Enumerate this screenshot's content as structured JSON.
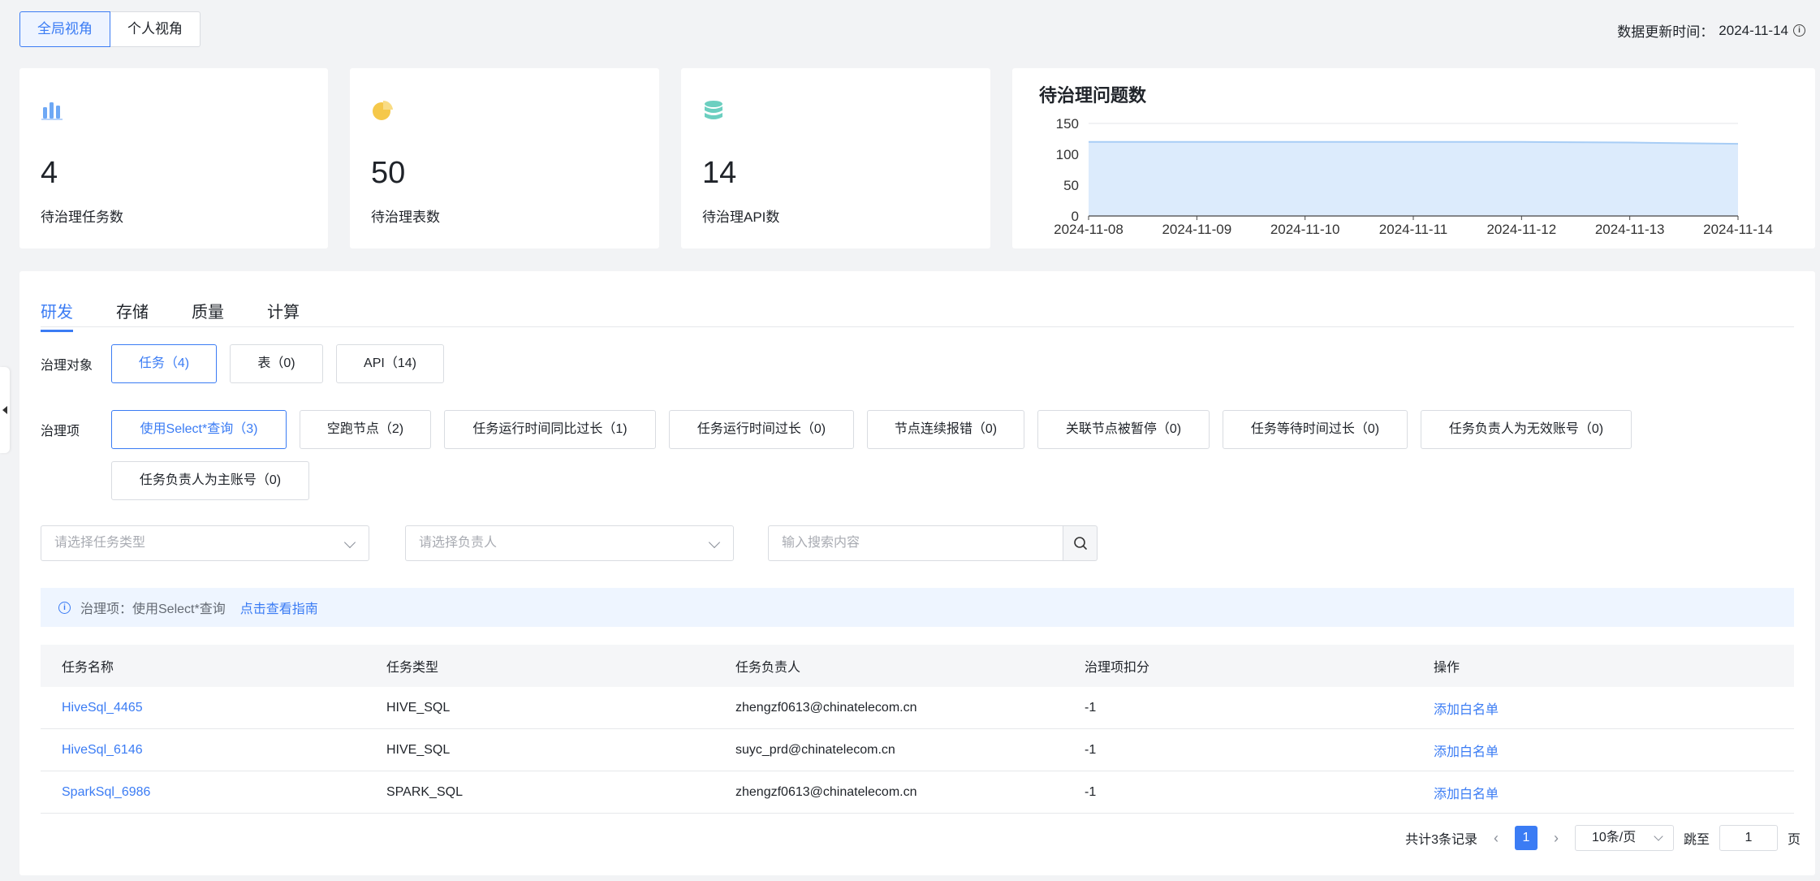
{
  "header": {
    "views": [
      {
        "label": "全局视角",
        "active": true
      },
      {
        "label": "个人视角",
        "active": false
      }
    ],
    "update_label": "数据更新时间：",
    "update_date": "2024-11-14"
  },
  "stats": [
    {
      "value": "4",
      "label": "待治理任务数",
      "icon": "bar-chart-icon",
      "color": "#6ea8f5"
    },
    {
      "value": "50",
      "label": "待治理表数",
      "icon": "pie-chart-icon",
      "color": "#f5c84a"
    },
    {
      "value": "14",
      "label": "待治理API数",
      "icon": "database-icon",
      "color": "#6ccfc0"
    }
  ],
  "chart_data": {
    "type": "area",
    "title": "待治理问题数",
    "x": [
      "2024-11-08",
      "2024-11-09",
      "2024-11-10",
      "2024-11-11",
      "2024-11-12",
      "2024-11-13",
      "2024-11-14"
    ],
    "series": [
      {
        "values": [
          120,
          120,
          120,
          120,
          120,
          119,
          117
        ]
      }
    ],
    "yticks": [
      "0",
      "50",
      "100",
      "150"
    ],
    "ylim": [
      0,
      150
    ],
    "grid": true,
    "color": "#a8cdf5",
    "fill": "#dcebfc"
  },
  "tabs": [
    {
      "label": "研发",
      "active": true
    },
    {
      "label": "存储",
      "active": false
    },
    {
      "label": "质量",
      "active": false
    },
    {
      "label": "计算",
      "active": false
    }
  ],
  "objects": {
    "label": "治理对象",
    "items": [
      {
        "label": "任务（4)",
        "active": true
      },
      {
        "label": "表（0)",
        "active": false
      },
      {
        "label": "API（14)",
        "active": false
      }
    ]
  },
  "governance": {
    "label": "治理项",
    "items": [
      {
        "label": "使用Select*查询（3)",
        "active": true
      },
      {
        "label": "空跑节点（2)",
        "active": false
      },
      {
        "label": "任务运行时间同比过长（1)",
        "active": false
      },
      {
        "label": "任务运行时间过长（0)",
        "active": false
      },
      {
        "label": "节点连续报错（0)",
        "active": false
      },
      {
        "label": "关联节点被暂停（0)",
        "active": false
      },
      {
        "label": "任务等待时间过长（0)",
        "active": false
      },
      {
        "label": "任务负责人为无效账号（0)",
        "active": false
      },
      {
        "label": "任务负责人为主账号（0)",
        "active": false
      }
    ]
  },
  "filters": {
    "task_type_placeholder": "请选择任务类型",
    "owner_placeholder": "请选择负责人",
    "search_placeholder": "输入搜索内容"
  },
  "notice": {
    "text": "治理项：使用Select*查询",
    "link": "点击查看指南"
  },
  "table": {
    "headers": [
      "任务名称",
      "任务类型",
      "任务负责人",
      "治理项扣分",
      "操作"
    ],
    "rows": [
      {
        "name": "HiveSql_4465",
        "type": "HIVE_SQL",
        "owner": "zhengzf0613@chinatelecom.cn",
        "score": "-1",
        "action": "添加白名单"
      },
      {
        "name": "HiveSql_6146",
        "type": "HIVE_SQL",
        "owner": "suyc_prd@chinatelecom.cn",
        "score": "-1",
        "action": "添加白名单"
      },
      {
        "name": "SparkSql_6986",
        "type": "SPARK_SQL",
        "owner": "zhengzf0613@chinatelecom.cn",
        "score": "-1",
        "action": "添加白名单"
      }
    ]
  },
  "pagination": {
    "total": "共计3条记录",
    "current": "1",
    "page_size": "10条/页",
    "jump_label": "跳至",
    "jump_value": "1",
    "page_unit": "页"
  }
}
